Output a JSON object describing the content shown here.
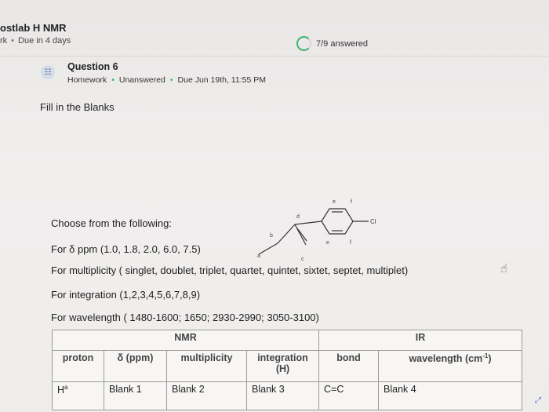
{
  "course": {
    "title": "ostlab H NMR",
    "sub_left": "rk",
    "due": "Due in 4 days"
  },
  "progress": {
    "label": "7/9 answered"
  },
  "question": {
    "title": "Question 6",
    "type": "Homework",
    "status": "Unanswered",
    "due": "Due Jun 19th, 11:55 PM"
  },
  "fill_title": "Fill in the Blanks",
  "instructions": {
    "choose": "Choose from the following:",
    "ppm": "For δ ppm (1.0, 1.8, 2.0, 6.0, 7.5)",
    "multiplicity": "For multiplicity ( singlet, doublet, triplet, quartet, quintet, sixtet, septet, multiplet)",
    "integration": "For integration (1,2,3,4,5,6,7,8,9)",
    "wavelength": "For wavelength ( 1480-1600; 1650; 2930-2990; 3050-3100)"
  },
  "molecule": {
    "labels": {
      "a": "a",
      "b": "b",
      "c": "c",
      "d": "d",
      "e1": "e",
      "e2": "e",
      "f1": "f",
      "f2": "f",
      "cl": "Cl"
    }
  },
  "table": {
    "group_nmr": "NMR",
    "group_ir": "IR",
    "headers": {
      "proton": "proton",
      "ppm": "δ (ppm)",
      "multiplicity": "multiplicity",
      "integration": "integration",
      "integration_unit": "(H)",
      "bond": "bond",
      "wavelength": "wavelength (cm",
      "wavelength_exp": "-1",
      "wavelength_close": ")"
    },
    "rows": [
      {
        "proton": "H",
        "proton_sup": "a",
        "ppm": "Blank 1",
        "multiplicity": "Blank 2",
        "integration": "Blank 3",
        "bond": "C=C",
        "wavelength": "Blank 4"
      }
    ]
  },
  "colors": {
    "accent_green": "#3cb371",
    "icon_blue": "#5a6e86"
  }
}
